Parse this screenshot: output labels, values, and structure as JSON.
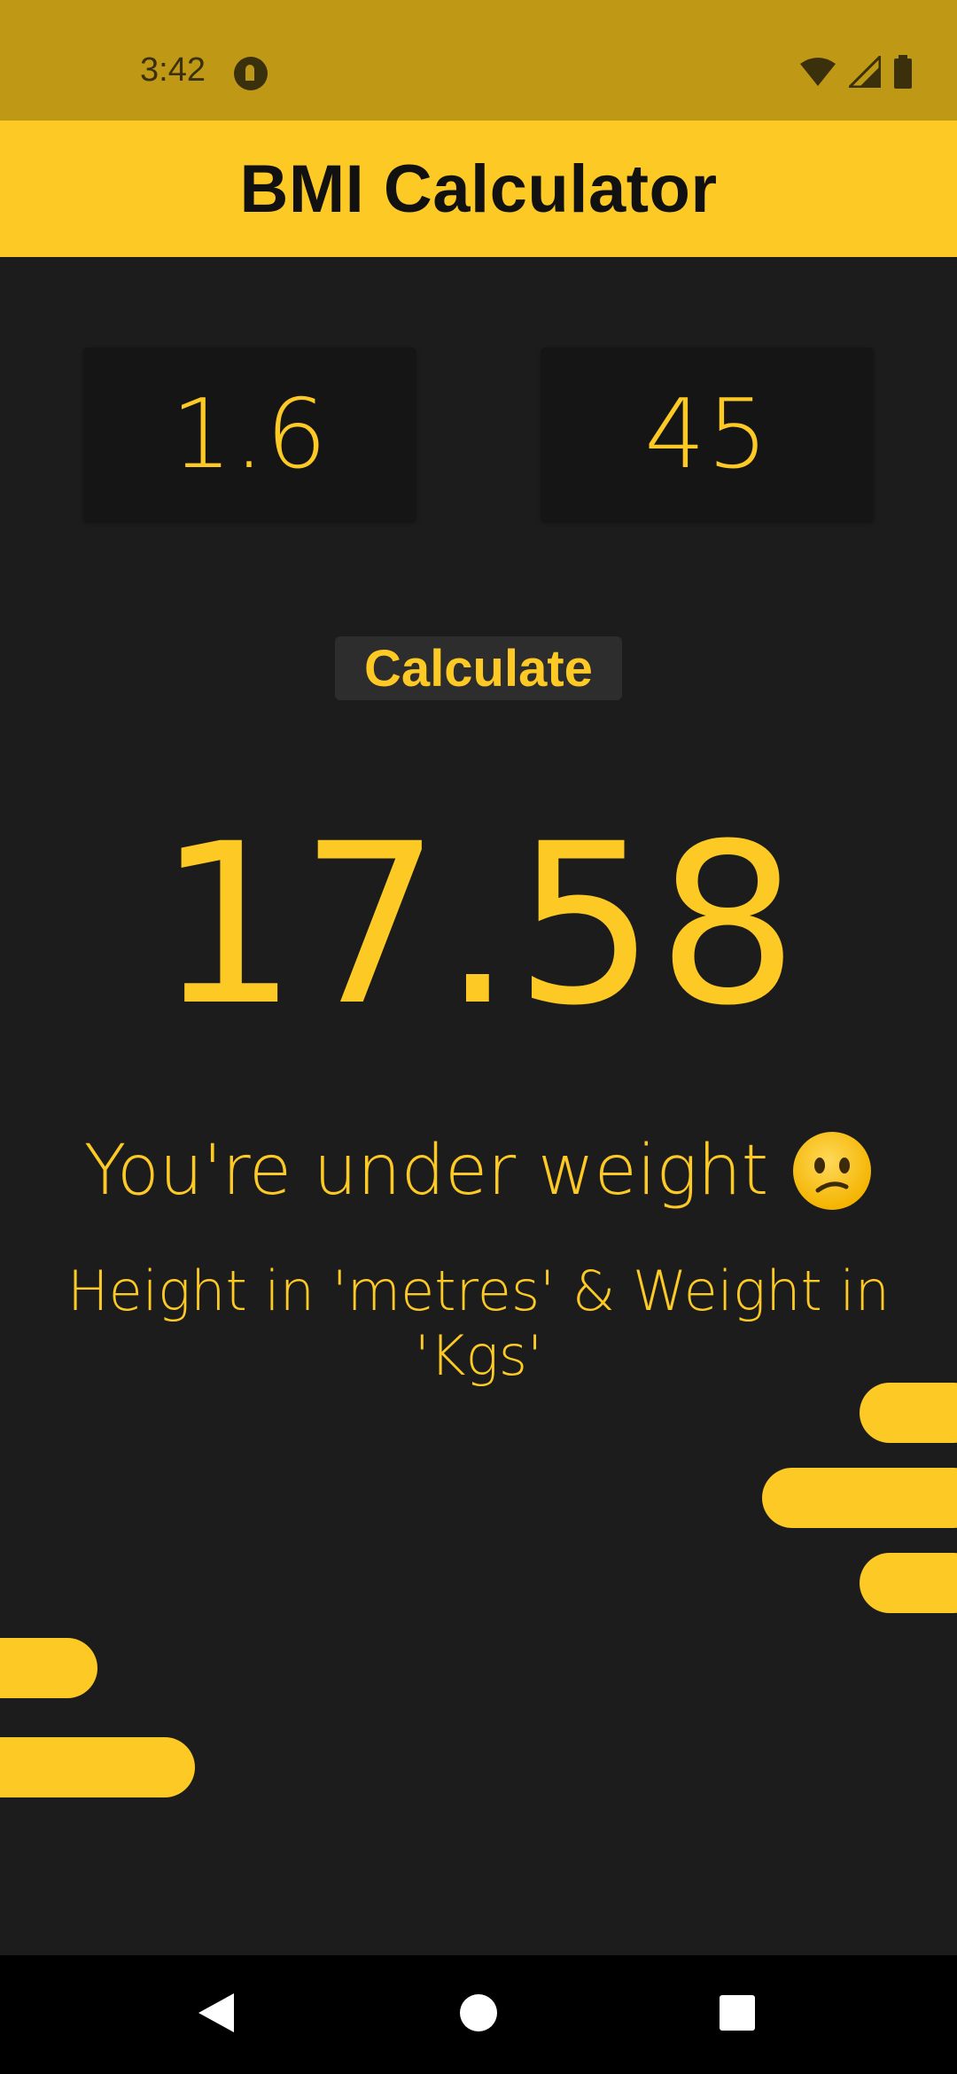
{
  "status_bar": {
    "time": "3:42",
    "icons": [
      "app-notification-icon",
      "wifi-icon",
      "signal-icon",
      "battery-icon"
    ]
  },
  "app_bar": {
    "title": "BMI Calculator"
  },
  "inputs": {
    "height_value": "1.6",
    "weight_value": "45"
  },
  "calculate_button": {
    "label": "Calculate"
  },
  "result": {
    "bmi_value": "17.58",
    "message": "You're under weight",
    "message_emoji": "confused-face-icon",
    "hint": "Height in 'metres' & Weight in 'Kgs'"
  },
  "navigation": {
    "buttons": [
      "back-icon",
      "home-icon",
      "recents-icon"
    ]
  },
  "colors": {
    "accent": "#fdc925",
    "status_bar": "#bf9816",
    "background": "#1c1c1c",
    "input_background": "#151515",
    "button_background": "#2d2d2d"
  }
}
